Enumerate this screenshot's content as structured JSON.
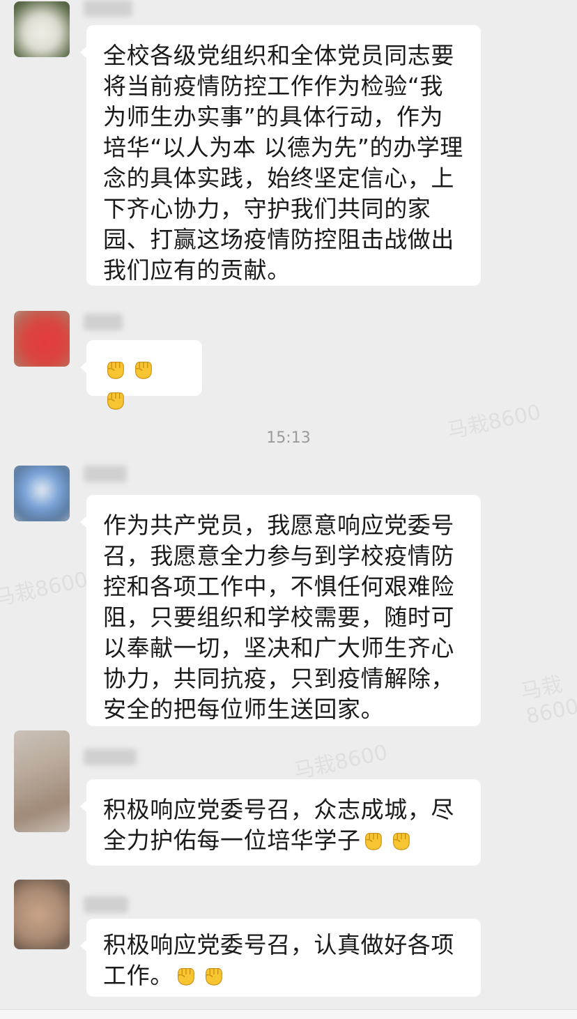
{
  "chat": {
    "timestamp": "15:13",
    "watermark": "马栽8600",
    "messages": [
      {
        "text": "全校各级党组织和全体党员同志要将当前疫情防控工作作为检验“我为师生办实事”的具体行动，作为培华“以人为本 以德为先”的办学理念的具体实践，始终坚定信心，上下齐心协力，守护我们共同的家园、打赢这场疫情防控阻击战做出我们应有的贡献。",
        "emoji_count": 0
      },
      {
        "text": "",
        "emoji_count": 3
      },
      {
        "text": "作为共产党员，我愿意响应党委号召，我愿意全力参与到学校疫情防控和各项工作中，不惧任何艰难险阻，只要组织和学校需要，随时可以奉献一切，坚决和广大师生齐心协力，共同抗疫，只到疫情解除，安全的把每位师生送回家。",
        "emoji_count": 0
      },
      {
        "text": "积极响应党委号召，众志成城，尽全力护佑每一位培华学子",
        "emoji_count": 2
      },
      {
        "text": "积极响应党委号召，认真做好各项工作。",
        "emoji_count": 2
      }
    ]
  },
  "colors": {
    "background": "#ededed",
    "bubble": "#ffffff",
    "text": "#1a1a1a",
    "timestamp": "#9a9a9a",
    "emoji_fill": "#f7c531"
  },
  "icons": {
    "emoji": "raised-fist-icon"
  }
}
